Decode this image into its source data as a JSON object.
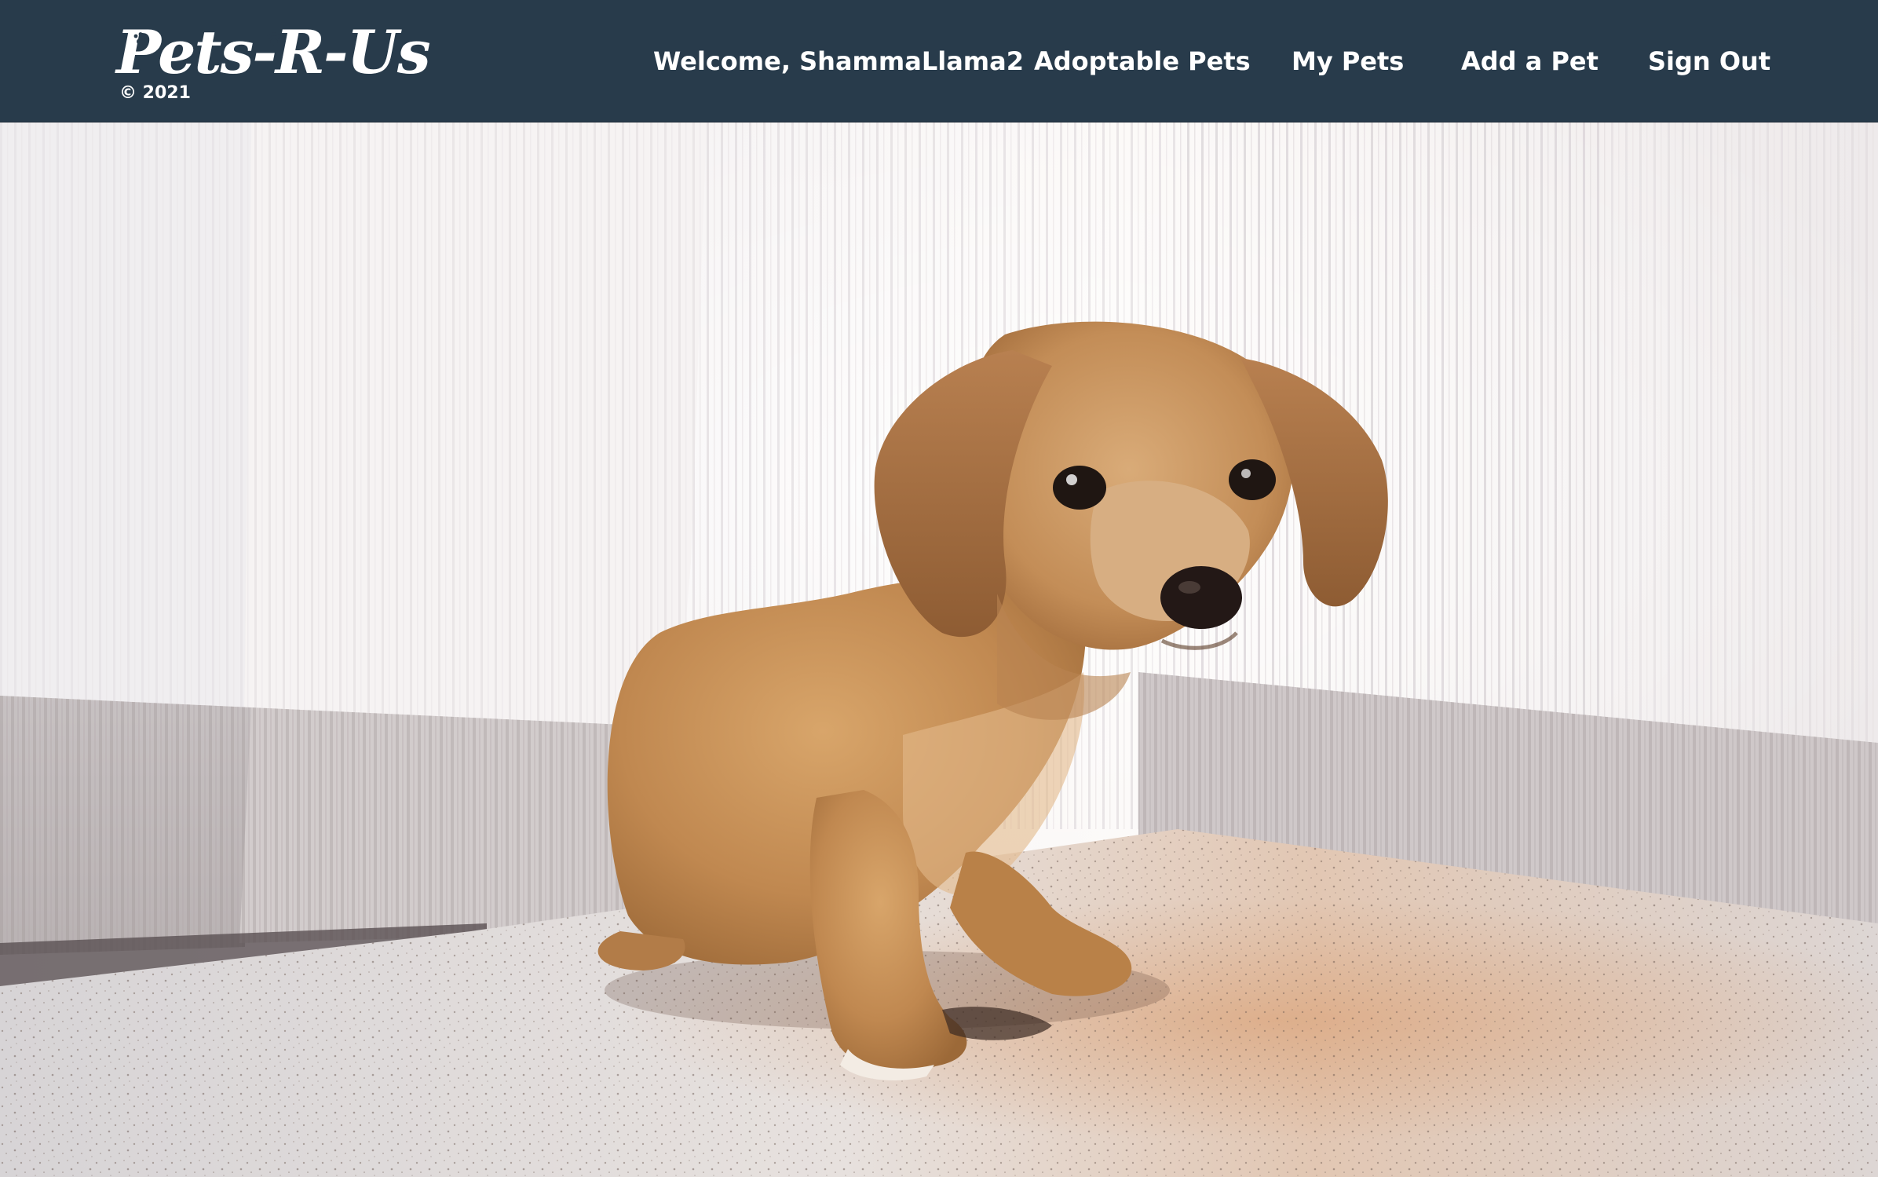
{
  "brand": {
    "logo_text": "Pets-R-Us",
    "copyright": "© 2021"
  },
  "nav": {
    "welcome": "Welcome, ShammaLlama2",
    "adoptable_pets": "Adoptable Pets",
    "my_pets": "My Pets",
    "add_pet": "Add a Pet",
    "sign_out": "Sign Out"
  },
  "hero": {
    "image_subject": "dachshund-puppy-photo"
  },
  "colors": {
    "navbar_bg": "#283b4b",
    "nav_text": "#ffffff"
  }
}
